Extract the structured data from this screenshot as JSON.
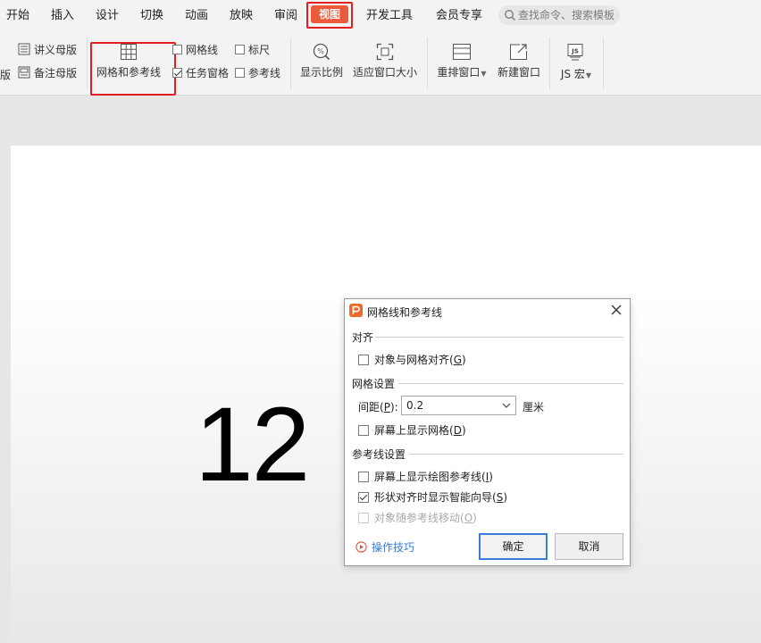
{
  "menubar": {
    "tabs": [
      "开始",
      "插入",
      "设计",
      "切换",
      "动画",
      "放映",
      "审阅",
      "视图",
      "开发工具",
      "会员专享"
    ],
    "active_tab": "视图",
    "search_placeholder": "查找命令、搜索模板"
  },
  "ribbon": {
    "handout_master": "讲义母版",
    "notes_master": "备注母版",
    "partial_left": "版",
    "grid_and_guides": "网格和参考线",
    "gridlines": "网格线",
    "task_pane": "任务窗格",
    "ruler": "标尺",
    "guides": "参考线",
    "zoom": "显示比例",
    "fit_window": "适应窗口大小",
    "rearrange_windows": "重排窗口",
    "new_window": "新建窗口",
    "js_macro": "JS 宏",
    "task_pane_checked": true,
    "gridlines_checked": false,
    "ruler_checked": false,
    "guides_checked": false
  },
  "slide": {
    "number_text": "12"
  },
  "dialog": {
    "title": "网格线和参考线",
    "section_align": "对齐",
    "snap_to_grid_text": "对象与网格对齐(",
    "snap_to_grid_key": "G",
    "snap_to_grid_checked": false,
    "section_grid": "网格设置",
    "spacing_text": "间距(",
    "spacing_key": "P",
    "spacing_suffix": "):",
    "spacing_value": "0.2",
    "unit": "厘米",
    "show_grid_text": "屏幕上显示网格(",
    "show_grid_key": "D",
    "show_grid_checked": false,
    "section_guides": "参考线设置",
    "show_guides_text": "屏幕上显示绘图参考线(",
    "show_guides_key": "I",
    "show_guides_checked": false,
    "smart_guides_text": "形状对齐时显示智能向导(",
    "smart_guides_key": "S",
    "smart_guides_checked": true,
    "move_with_guides_text": "对象随参考线移动(",
    "move_with_guides_key": "O",
    "move_with_guides_checked": false,
    "tips": "操作技巧",
    "ok": "确定",
    "cancel": "取消",
    "close_paren": ")"
  },
  "colors": {
    "active_tab_bg": "#ea5a3b",
    "highlight_box": "#e31e1e",
    "primary_blue": "#3c7bd6",
    "app_logo": "#ea6a2a"
  }
}
